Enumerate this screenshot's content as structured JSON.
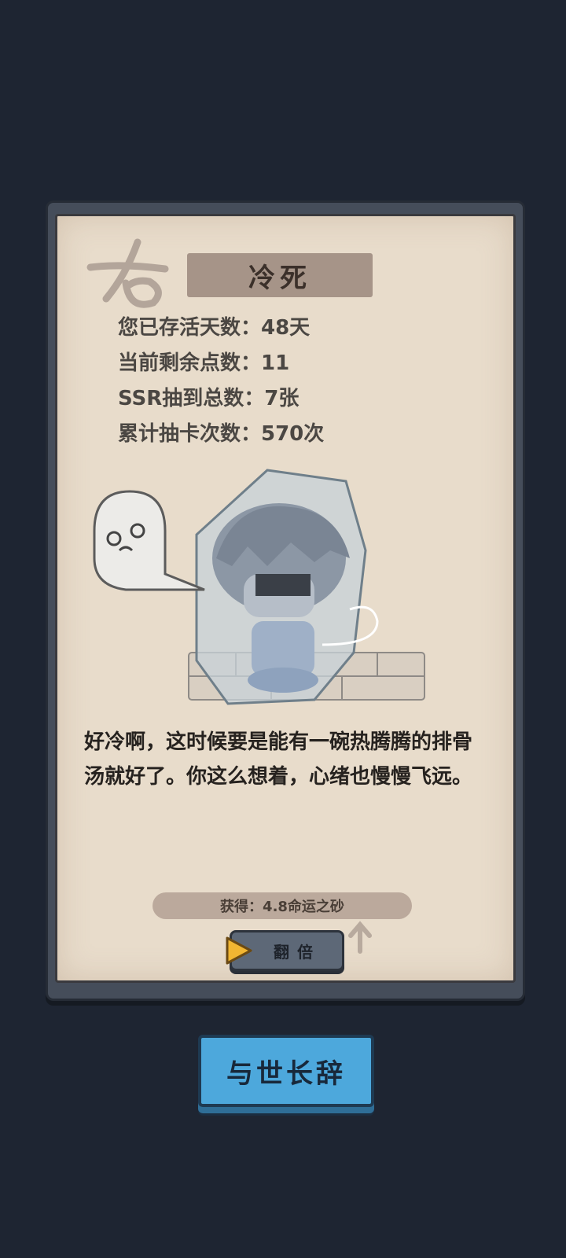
{
  "card": {
    "title": "冷死",
    "stats": [
      "您已存活天数：48天",
      "当前剩余点数：11",
      "SSR抽到总数：7张",
      "累计抽卡次数：570次"
    ],
    "story": "好冷啊，这时候要是能有一碗热腾腾的排骨汤就好了。你这么想着，心绪也慢慢飞远。",
    "reward": "获得：4.8命运之砂",
    "double_label": "翻倍"
  },
  "exit_button_label": "与世长辞",
  "colors": {
    "background": "#1e2532",
    "paper": "#e8dccb",
    "exit_button": "#4da8dc"
  },
  "icons": {
    "play": "play-triangle-icon",
    "stamp": "fate-stamp-icon"
  }
}
